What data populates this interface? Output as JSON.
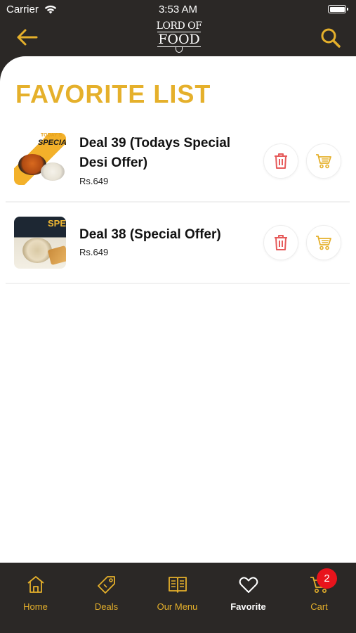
{
  "status_bar": {
    "carrier": "Carrier",
    "time": "3:53 AM"
  },
  "header": {
    "logo_line1": "LORD OF",
    "logo_line2": "FOOD",
    "back_icon": "arrow-left-icon",
    "search_icon": "search-icon"
  },
  "page_title": "FAVORITE LIST",
  "favorites": [
    {
      "name": "Deal 39 (Todays Special Desi Offer)",
      "price": "Rs.649",
      "thumb_text": "SPECIAL",
      "thumb_top": "TODAY'S"
    },
    {
      "name": "Deal 38 (Special Offer)",
      "price": "Rs.649",
      "thumb_text": "SPEC"
    }
  ],
  "tabs": [
    {
      "label": "Home",
      "icon": "home-icon"
    },
    {
      "label": "Deals",
      "icon": "tag-icon"
    },
    {
      "label": "Our Menu",
      "icon": "book-icon"
    },
    {
      "label": "Favorite",
      "icon": "heart-icon",
      "active": true
    },
    {
      "label": "Cart",
      "icon": "cart-icon"
    }
  ],
  "cart_badge": "2",
  "colors": {
    "accent": "#e5b02b",
    "dark": "#2b2826",
    "danger": "#e8141c"
  }
}
